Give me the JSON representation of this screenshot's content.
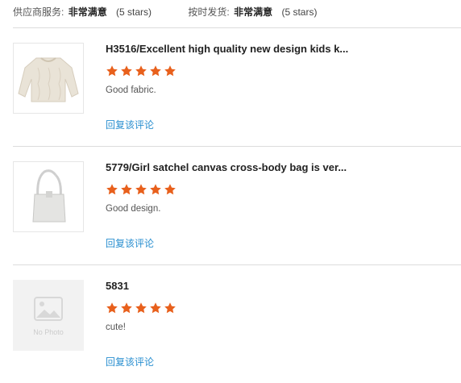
{
  "summary": {
    "supplier_service": {
      "label": "供应商服务:",
      "value": "非常满意",
      "stars_text": "(5 stars)"
    },
    "on_time_delivery": {
      "label": "按时发货:",
      "value": "非常满意",
      "stars_text": "(5 stars)"
    }
  },
  "colors": {
    "star": "#e8601c",
    "reply_link": "#2a8fd0"
  },
  "reviews": [
    {
      "title": "H3516/Excellent high quality new design kids k...",
      "rating": 5,
      "comment": "Good fabric.",
      "reply_label": "回复该评论",
      "thumb_icon": "sweater-image"
    },
    {
      "title": "5779/Girl satchel canvas cross-body bag is ver...",
      "rating": 5,
      "comment": "Good design.",
      "reply_label": "回复该评论",
      "thumb_icon": "bag-image"
    },
    {
      "title": "5831",
      "rating": 5,
      "comment": "cute!",
      "reply_label": "回复该评论",
      "thumb_icon": "no-photo-placeholder",
      "thumb_text": "No Photo"
    }
  ]
}
